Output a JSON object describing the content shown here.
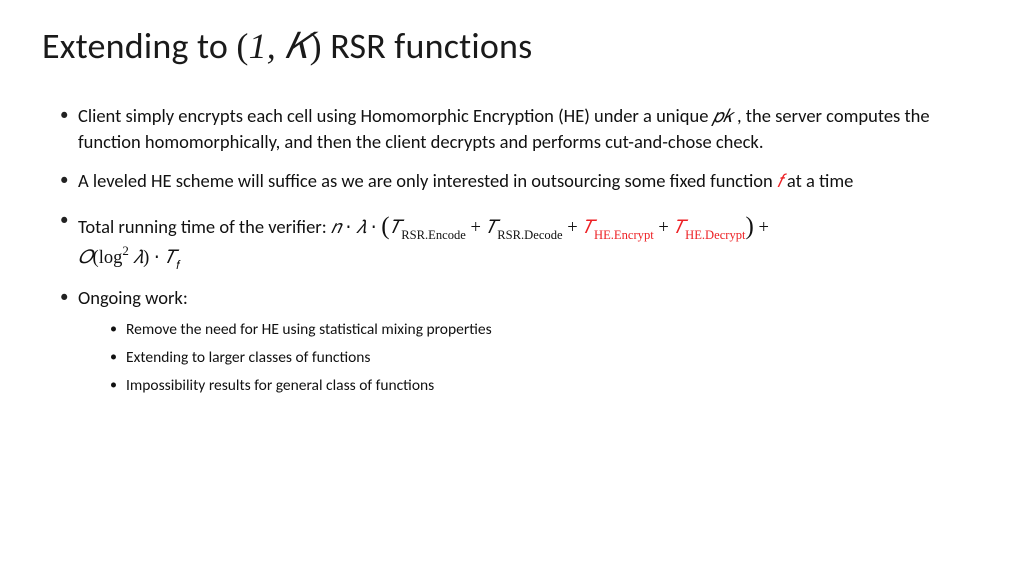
{
  "title": {
    "before": "Extending to ",
    "math_open": "(",
    "math_a": "1, 𝐾",
    "math_close": ")",
    "after": " RSR functions"
  },
  "bullets": {
    "b1_a": "Client simply encrypts each cell using Homomorphic Encryption (HE) under a unique ",
    "b1_pk": "𝑝𝑘",
    "b1_b": " , the server computes the function homomorphically, and then the client decrypts and performs cut-and-chose check.",
    "b2_a": "A leveled HE scheme will suffice as we are only interested in outsourcing some fixed function ",
    "b2_f": "𝑓",
    "b2_b": " at a time",
    "b3_lead": " Total running time of the verifier: ",
    "b3_n": "𝑛",
    "b3_dot1": " ⋅ ",
    "b3_lam": "𝜆",
    "b3_dot2": " ⋅ ",
    "b3_open": "(",
    "b3_T1": "𝑇",
    "b3_T1s": "RSR.Encode",
    "b3_plus1": " + ",
    "b3_T2": "𝑇",
    "b3_T2s": "RSR.Decode",
    "b3_plus2": " + ",
    "b3_T3": "𝑇",
    "b3_T3s": "HE.Encrypt",
    "b3_plus3": " + ",
    "b3_T4": "𝑇",
    "b3_T4s": "HE.Decrypt",
    "b3_close": ")",
    "b3_plus4": " + ",
    "b3_O": "𝑂",
    "b3_Oopen": "(",
    "b3_log": "log",
    "b3_exp": "2",
    "b3_sp": " ",
    "b3_lam2": "𝜆",
    "b3_Oclose": ")",
    "b3_dot3": " ⋅ ",
    "b3_Tf": "𝑇",
    "b3_Tfs": "𝑓",
    "b4": "Ongoing work:",
    "s1": "Remove the need for HE using statistical mixing properties",
    "s2": "Extending to larger classes of functions",
    "s3": "Impossibility results for general class of functions"
  }
}
